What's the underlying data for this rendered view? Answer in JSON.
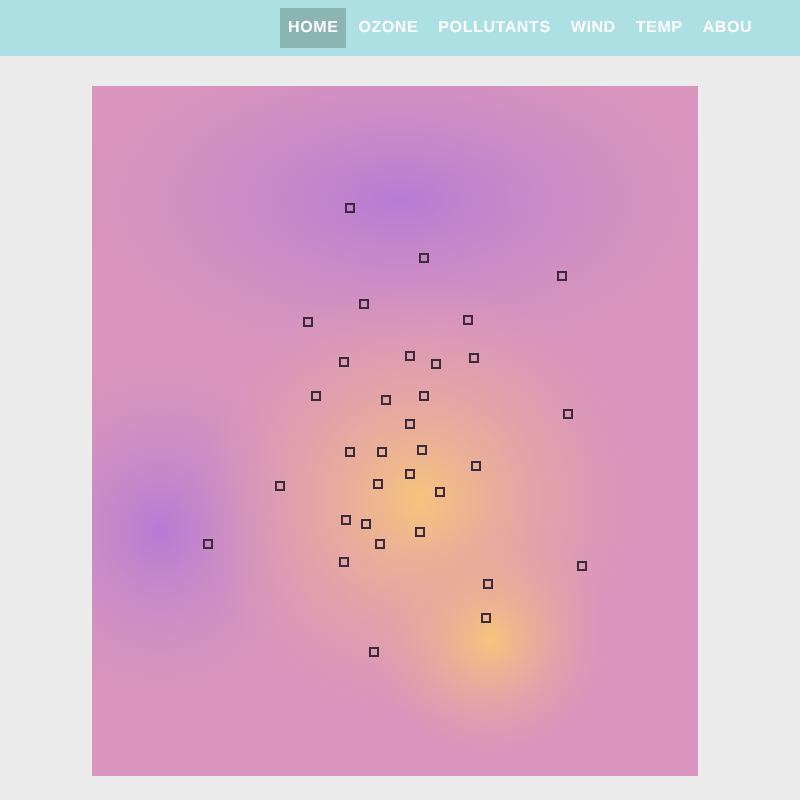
{
  "nav": {
    "items": [
      {
        "label": "HOME",
        "selected": true
      },
      {
        "label": "OZONE",
        "selected": false
      },
      {
        "label": "POLLUTANTS",
        "selected": false
      },
      {
        "label": "WIND",
        "selected": false
      },
      {
        "label": "TEMP",
        "selected": false
      },
      {
        "label": "ABOU",
        "selected": false
      }
    ]
  }
}
